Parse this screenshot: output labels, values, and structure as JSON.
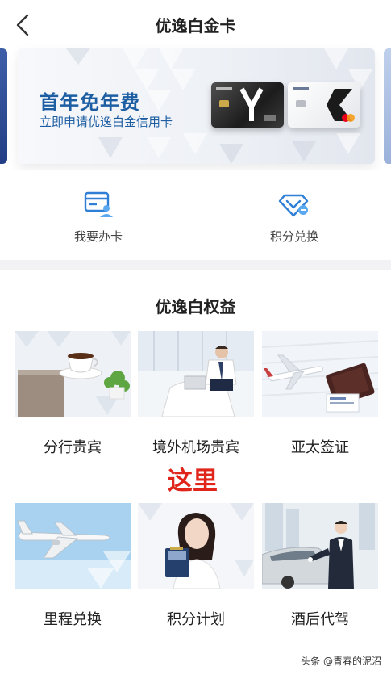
{
  "header": {
    "title": "优逸白金卡",
    "back_icon": "chevron-left-icon"
  },
  "banner": {
    "headline": "首年免年费",
    "subline": "立即申请优逸白金信用卡"
  },
  "quick_actions": [
    {
      "label": "我要办卡",
      "icon": "card-apply-icon"
    },
    {
      "label": "积分兑换",
      "icon": "points-exchange-icon"
    }
  ],
  "section": {
    "title": "优逸白权益"
  },
  "benefits": [
    {
      "label": "分行贵宾"
    },
    {
      "label": "境外机场贵宾"
    },
    {
      "label": "亚太签证"
    },
    {
      "label": "里程兑换"
    },
    {
      "label": "积分计划"
    },
    {
      "label": "酒后代驾"
    }
  ],
  "annotation": "这里",
  "watermark": "头条 @青春的泥沼",
  "colors": {
    "accent": "#1d5ea3",
    "icon_blue": "#2f7fd6",
    "annotation_red": "#e0251b"
  }
}
